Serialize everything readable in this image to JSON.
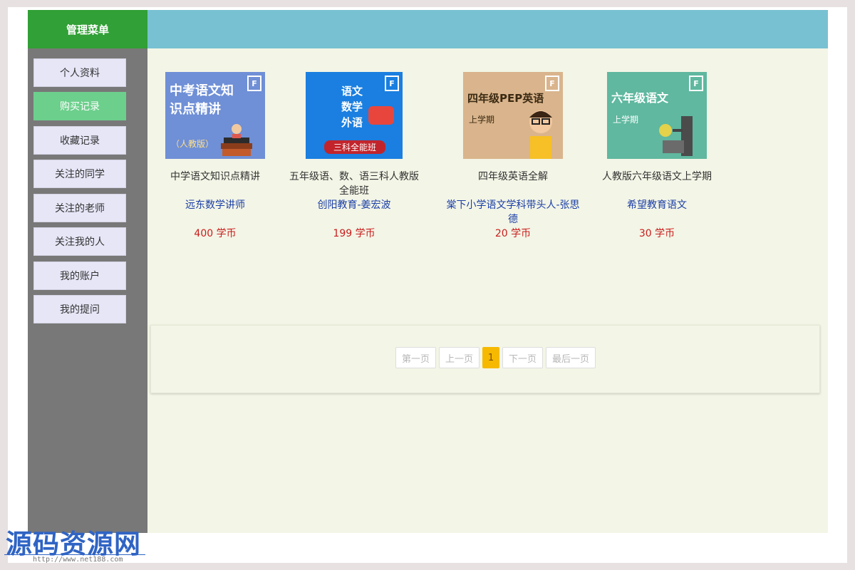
{
  "menu": {
    "title": "管理菜单"
  },
  "sidebar": {
    "items": [
      {
        "label": "个人资料",
        "active": false
      },
      {
        "label": "购买记录",
        "active": true
      },
      {
        "label": "收藏记录",
        "active": false
      },
      {
        "label": "关注的同学",
        "active": false
      },
      {
        "label": "关注的老师",
        "active": false
      },
      {
        "label": "关注我的人",
        "active": false
      },
      {
        "label": "我的账户",
        "active": false
      },
      {
        "label": "我的提问",
        "active": false
      }
    ]
  },
  "courses": [
    {
      "thumb_title": "中考语文知\n识点精讲",
      "thumb_sub": "（人教版）",
      "thumb_color": "#6f8fd6",
      "name": "中学语文知识点精讲",
      "teacher": "远东数学讲师",
      "price": "400 学币"
    },
    {
      "thumb_title": "语文\n数学\n外语",
      "thumb_sub": "三科全能班",
      "thumb_color": "#1a7fe0",
      "name": "五年级语、数、语三科人教版全能班",
      "teacher": "创阳教育-姜宏波",
      "price": "199 学币"
    },
    {
      "thumb_title": "四年级PEP英语",
      "thumb_sub": "上学期",
      "thumb_color": "#d9b48c",
      "name": "四年级英语全解",
      "teacher": "棠下小学语文学科带头人-张思德",
      "price": "20 学币"
    },
    {
      "thumb_title": "六年级语文",
      "thumb_sub": "上学期",
      "thumb_color": "#5fb89f",
      "name": "人教版六年级语文上学期",
      "teacher": "希望教育语文",
      "price": "30 学币"
    }
  ],
  "pagination": {
    "first": "第一页",
    "prev": "上一页",
    "current": "1",
    "next": "下一页",
    "last": "最后一页"
  },
  "watermark": {
    "text": "源码资源网",
    "url": "http://www.net188.com"
  }
}
